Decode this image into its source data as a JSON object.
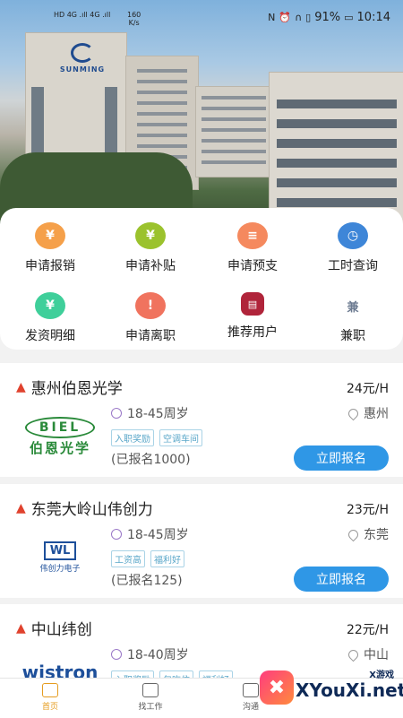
{
  "status_bar": {
    "signal_left_top": "HD 4G .ıll 4G .ıll",
    "net_speed_value": "160",
    "net_speed_unit": "K/s",
    "nfc": "N",
    "battery": "91%",
    "time": "10:14"
  },
  "hero": {
    "logo_text": "SUNMING"
  },
  "menu": {
    "items": [
      {
        "label": "申请报销",
        "color": "#f5a04a",
        "glyph": "¥"
      },
      {
        "label": "申请补贴",
        "color": "#9bc22d",
        "glyph": "¥"
      },
      {
        "label": "申请预支",
        "color": "#f5895e",
        "glyph": "≡"
      },
      {
        "label": "工时查询",
        "color": "#3e86d8",
        "glyph": "◷"
      },
      {
        "label": "发资明细",
        "color": "#3fcf9a",
        "glyph": "¥"
      },
      {
        "label": "申请离职",
        "color": "#f0735e",
        "glyph": "!"
      },
      {
        "label": "推荐用户",
        "color": "#b0243a",
        "glyph": "▤"
      },
      {
        "label": "兼职",
        "color": "#9aa6b8",
        "glyph": "兼"
      }
    ]
  },
  "jobs": [
    {
      "company": "惠州伯恩光学",
      "wage": "24元/H",
      "age": "18-45周岁",
      "location": "惠州",
      "tags": [
        "入职奖励",
        "空调车间"
      ],
      "registered": "(已报名1000)",
      "button": "立即报名",
      "logo_main": "BIEL",
      "logo_sub": "伯恩光学"
    },
    {
      "company": "东莞大岭山伟创力",
      "wage": "23元/H",
      "age": "18-45周岁",
      "location": "东莞",
      "tags": [
        "工资高",
        "福利好"
      ],
      "registered": "(已报名125)",
      "button": "立即报名",
      "logo_main": "WL",
      "logo_sub": "伟创力电子"
    },
    {
      "company": "中山纬创",
      "wage": "22元/H",
      "age": "18-40周岁",
      "location": "中山",
      "tags": [
        "入职奖励",
        "包吃住",
        "福利好"
      ],
      "registered": "",
      "button": "",
      "logo_main": "wistron",
      "logo_sub": ""
    }
  ],
  "bottom_nav": {
    "items": [
      {
        "label": "首页",
        "active": true
      },
      {
        "label": "找工作",
        "active": false
      },
      {
        "label": "沟通",
        "active": false
      }
    ]
  },
  "watermark": {
    "site": "XYouXi.net",
    "tag": "X游戏",
    "mark": "✖"
  }
}
